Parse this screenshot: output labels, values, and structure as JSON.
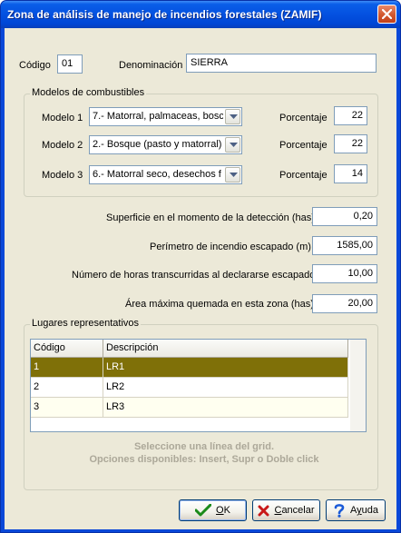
{
  "window": {
    "title": "Zona de análisis de manejo de incendios forestales (ZAMIF)"
  },
  "header": {
    "codigo_label": "Código",
    "codigo_value": "01",
    "denominacion_label": "Denominación",
    "denominacion_value": "SIERRA"
  },
  "modelos": {
    "group_title": "Modelos de combustibles",
    "porcentaje_label": "Porcentaje",
    "rows": [
      {
        "label": "Modelo 1",
        "value": "7.- Matorral, palmaceas, bosc",
        "porcentaje": "22"
      },
      {
        "label": "Modelo 2",
        "value": "2.- Bosque (pasto y matorral)",
        "porcentaje": "22"
      },
      {
        "label": "Modelo 3",
        "value": "6.- Matorral seco, desechos f",
        "porcentaje": "14"
      }
    ]
  },
  "metrics": [
    {
      "label": "Superficie en el momento de la detección (has)",
      "value": "0,20"
    },
    {
      "label": "Perímetro de incendio escapado (m)",
      "value": "1585,00"
    },
    {
      "label": "Número de horas transcurridas al declararse escapado",
      "value": "10,00"
    },
    {
      "label": "Área máxima quemada en esta zona (has)",
      "value": "20,00"
    }
  ],
  "lugares": {
    "group_title": "Lugares representativos",
    "columns": [
      "Código",
      "Descripción"
    ],
    "rows": [
      {
        "codigo": "1",
        "descripcion": "LR1"
      },
      {
        "codigo": "2",
        "descripcion": "LR2"
      },
      {
        "codigo": "3",
        "descripcion": "LR3"
      }
    ],
    "hint_line1": "Seleccione una línea del grid.",
    "hint_line2": "Opciones disponibles: Insert, Supr o  Doble click"
  },
  "buttons": {
    "ok_prefix": "",
    "ok_accel": "O",
    "ok_rest": "K",
    "cancel_accel": "C",
    "cancel_rest": "ancelar",
    "help_prefix": "A",
    "help_accel": "y",
    "help_rest": "uda"
  },
  "colors": {
    "titlebar": "#0451e0",
    "selected_row": "#7f7008",
    "dialog_bg": "#ece9d8",
    "ok_icon": "#1a8a1a",
    "cancel_icon": "#c81818",
    "help_icon": "#1a5ad8"
  },
  "icons": {
    "close": "close-icon",
    "ok": "check-icon",
    "cancel": "x-icon",
    "help": "question-icon"
  }
}
